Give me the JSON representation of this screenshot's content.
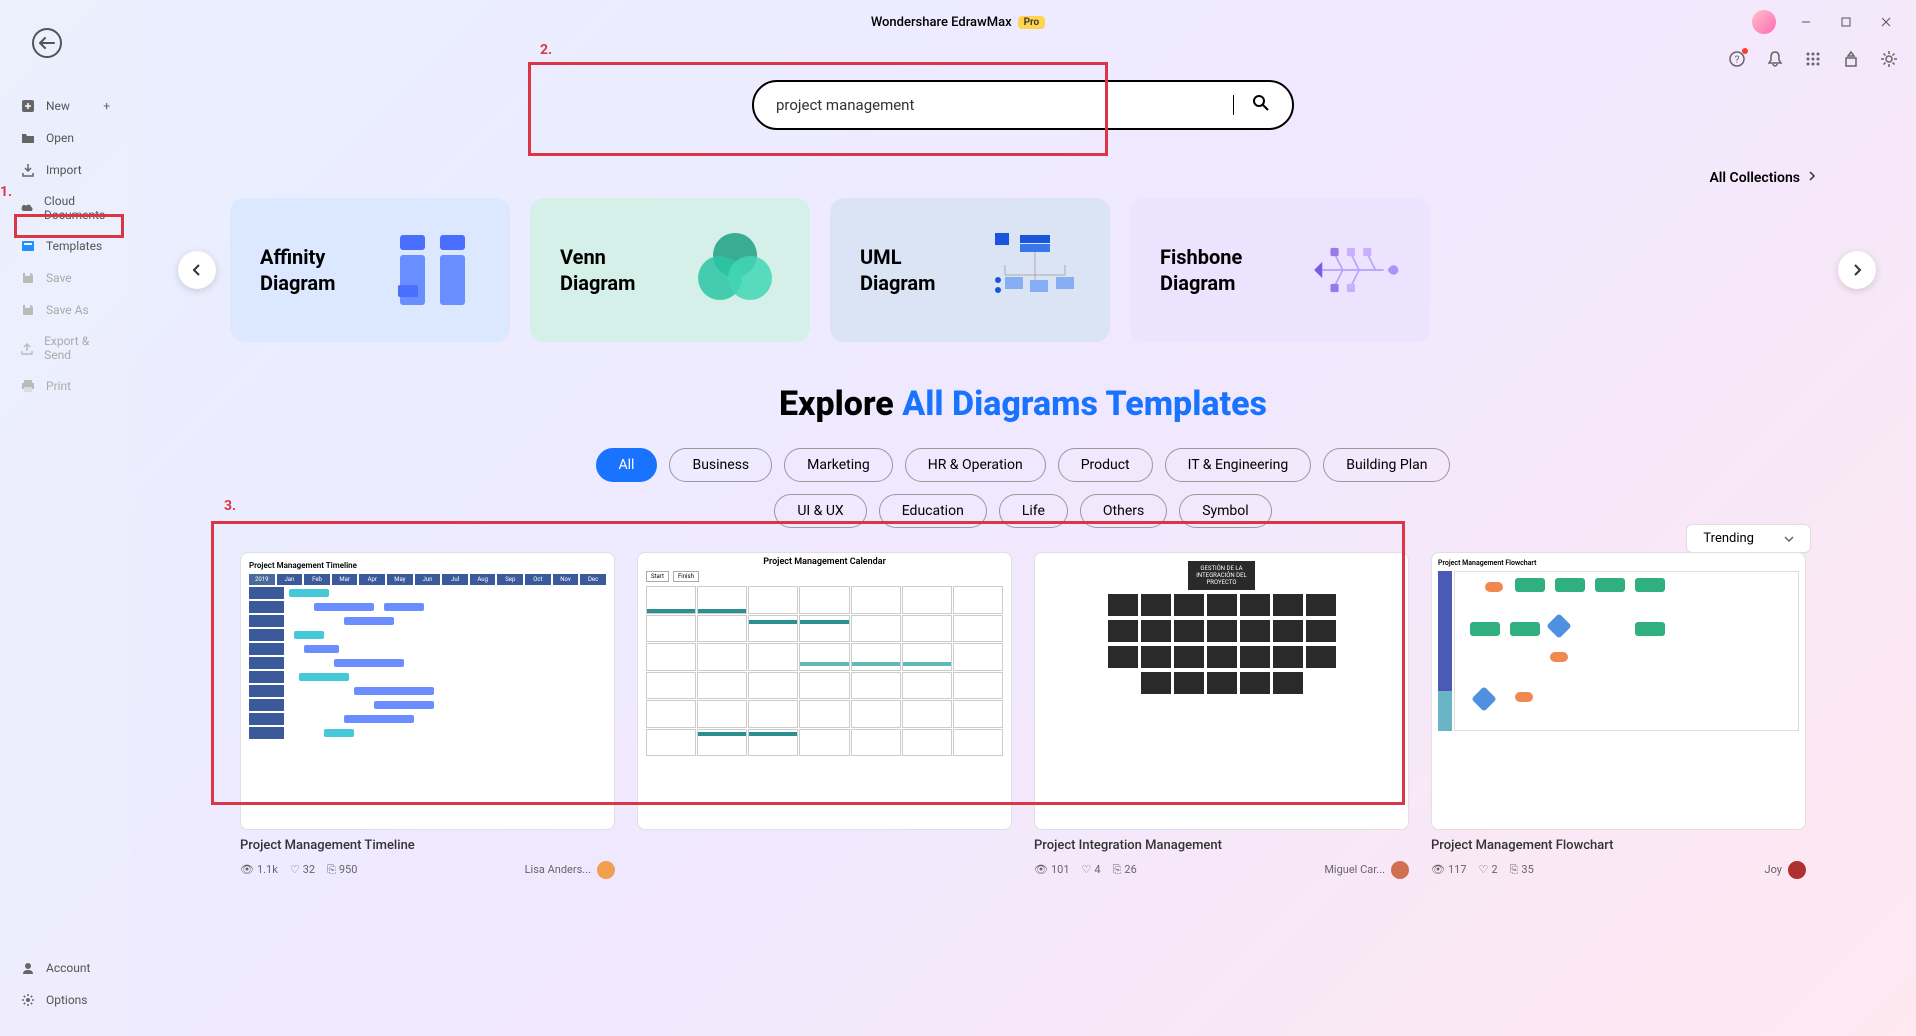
{
  "titlebar": {
    "app_name": "Wondershare EdrawMax",
    "badge": "Pro"
  },
  "sidebar": {
    "items": [
      {
        "label": "New",
        "icon": "plus-box",
        "has_add": true
      },
      {
        "label": "Open",
        "icon": "folder"
      },
      {
        "label": "Import",
        "icon": "import"
      },
      {
        "label": "Cloud Documents",
        "icon": "cloud"
      },
      {
        "label": "Templates",
        "icon": "templates",
        "active": true
      },
      {
        "label": "Save",
        "icon": "save",
        "disabled": true
      },
      {
        "label": "Save As",
        "icon": "save-as",
        "disabled": true
      },
      {
        "label": "Export & Send",
        "icon": "export",
        "disabled": true
      },
      {
        "label": "Print",
        "icon": "print",
        "disabled": true
      }
    ],
    "bottom": [
      {
        "label": "Account",
        "icon": "account"
      },
      {
        "label": "Options",
        "icon": "options"
      }
    ]
  },
  "annotations": {
    "one": "1.",
    "two": "2.",
    "three": "3."
  },
  "search": {
    "value": "project management"
  },
  "all_collections": "All Collections",
  "explore": {
    "prefix": "Explore ",
    "highlight": "All Diagrams Templates"
  },
  "categories": [
    {
      "name": "Affinity Diagram"
    },
    {
      "name": "Venn Diagram"
    },
    {
      "name": "UML Diagram"
    },
    {
      "name": "Fishbone Diagram"
    }
  ],
  "filters": {
    "row1": [
      "All",
      "Business",
      "Marketing",
      "HR & Operation",
      "Product",
      "IT & Engineering",
      "Building Plan"
    ],
    "row2": [
      "UI & UX",
      "Education",
      "Life",
      "Others",
      "Symbol"
    ],
    "active": "All"
  },
  "sort": {
    "value": "Trending"
  },
  "templates": [
    {
      "title": "Project Management Timeline",
      "views": "1.1k",
      "likes": "32",
      "copies": "950",
      "author": "Lisa Anders..."
    },
    {
      "title": "Project Management Calendar",
      "views": "",
      "likes": "",
      "copies": "",
      "author": ""
    },
    {
      "title": "Project Integration Management",
      "views": "101",
      "likes": "4",
      "copies": "26",
      "author": "Miguel Car..."
    },
    {
      "title": "Project Management Flowchart",
      "views": "117",
      "likes": "2",
      "copies": "35",
      "author": "Joy"
    }
  ],
  "thumb_calendar_title": "Project Management Calendar",
  "thumb_gantt_title": "Project Management Timeline",
  "thumb_fc_title": "Project Management Flowchart"
}
